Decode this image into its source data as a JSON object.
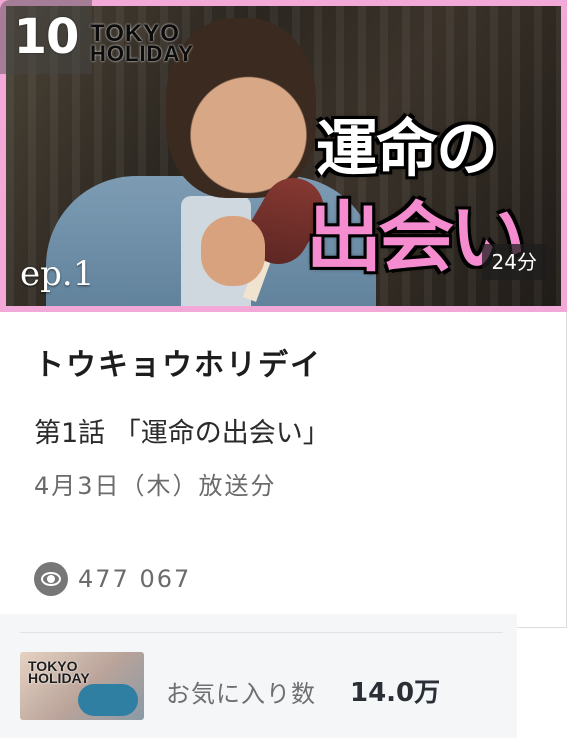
{
  "thumbnail": {
    "rank": "10",
    "logo_line1": "TOKYO",
    "logo_line2": "HOLIDAY",
    "title_line1": "運命の",
    "title_line2": "出会い",
    "episode_label": "ep.1",
    "duration": "24分"
  },
  "info": {
    "series_title": "トウキョウホリデイ",
    "episode_title": "第1話 「運命の出会い」",
    "broadcast_date": "4月3日（木）放送分",
    "views": "477 067"
  },
  "favorites": {
    "thumb_logo_line1": "TOKYO",
    "thumb_logo_line2": "HOLIDAY",
    "label": "お気に入り数",
    "count": "14.0万"
  },
  "colors": {
    "frame_pink": "#f3a9d8",
    "title_pink": "#f58ccf",
    "fav_bg": "#f4f6f8"
  }
}
